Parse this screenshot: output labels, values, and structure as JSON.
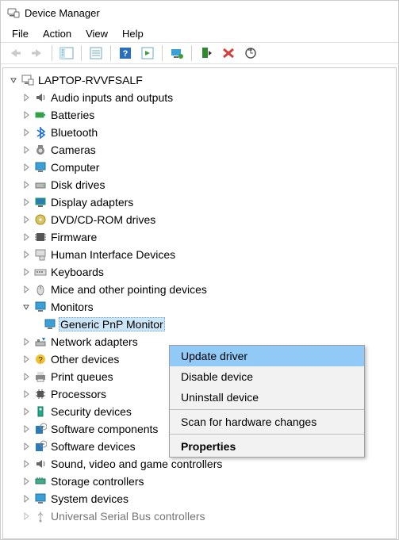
{
  "window": {
    "title": "Device Manager"
  },
  "menubar": {
    "file": "File",
    "action": "Action",
    "view": "View",
    "help": "Help"
  },
  "root": {
    "label": "LAPTOP-RVVFSALF"
  },
  "categories": {
    "audio": "Audio inputs and outputs",
    "batteries": "Batteries",
    "bluetooth": "Bluetooth",
    "cameras": "Cameras",
    "computer": "Computer",
    "disk": "Disk drives",
    "display": "Display adapters",
    "dvd": "DVD/CD-ROM drives",
    "firmware": "Firmware",
    "hid": "Human Interface Devices",
    "keyboards": "Keyboards",
    "mice": "Mice and other pointing devices",
    "monitors": "Monitors",
    "monitor_child": "Generic PnP Monitor",
    "network": "Network adapters",
    "other": "Other devices",
    "printq": "Print queues",
    "processors": "Processors",
    "security": "Security devices",
    "swcomp": "Software components",
    "swdev": "Software devices",
    "sound": "Sound, video and game controllers",
    "storage": "Storage controllers",
    "system": "System devices",
    "usb": "Universal Serial Bus controllers"
  },
  "context_menu": {
    "update": "Update driver",
    "disable": "Disable device",
    "uninstall": "Uninstall device",
    "scan": "Scan for hardware changes",
    "properties": "Properties"
  }
}
